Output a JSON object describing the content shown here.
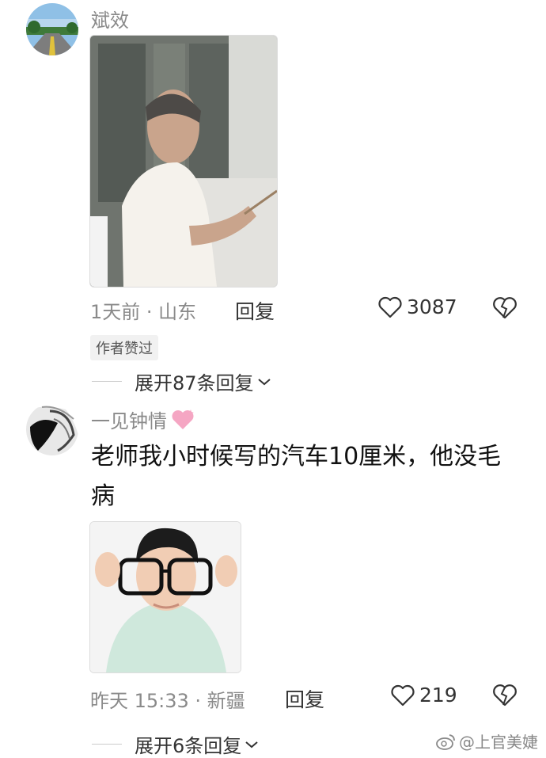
{
  "comments": [
    {
      "username": "斌效",
      "meta": "1天前 · 山东",
      "reply_label": "回复",
      "likes": "3087",
      "badge": "作者赞过",
      "expand_label": "展开87条回复"
    },
    {
      "username": "一见钟情",
      "text": "老师我小时候写的汽车10厘米，他没毛病",
      "meta": "昨天 15:33 · 新疆",
      "reply_label": "回复",
      "likes": "219",
      "expand_label": "展开6条回复"
    }
  ],
  "watermark": "@上官美婕",
  "icons": {
    "like": "heart-outline-icon",
    "dislike": "broken-heart-icon",
    "expand": "chevron-down-icon",
    "username_decoration": "pink-heart-icon",
    "watermark": "weibo-icon"
  },
  "colors": {
    "secondary_text": "#8a8a8a",
    "primary_text": "#111111",
    "badge_bg": "#f1f1f1",
    "heart_pink": "#f5a6c3"
  }
}
